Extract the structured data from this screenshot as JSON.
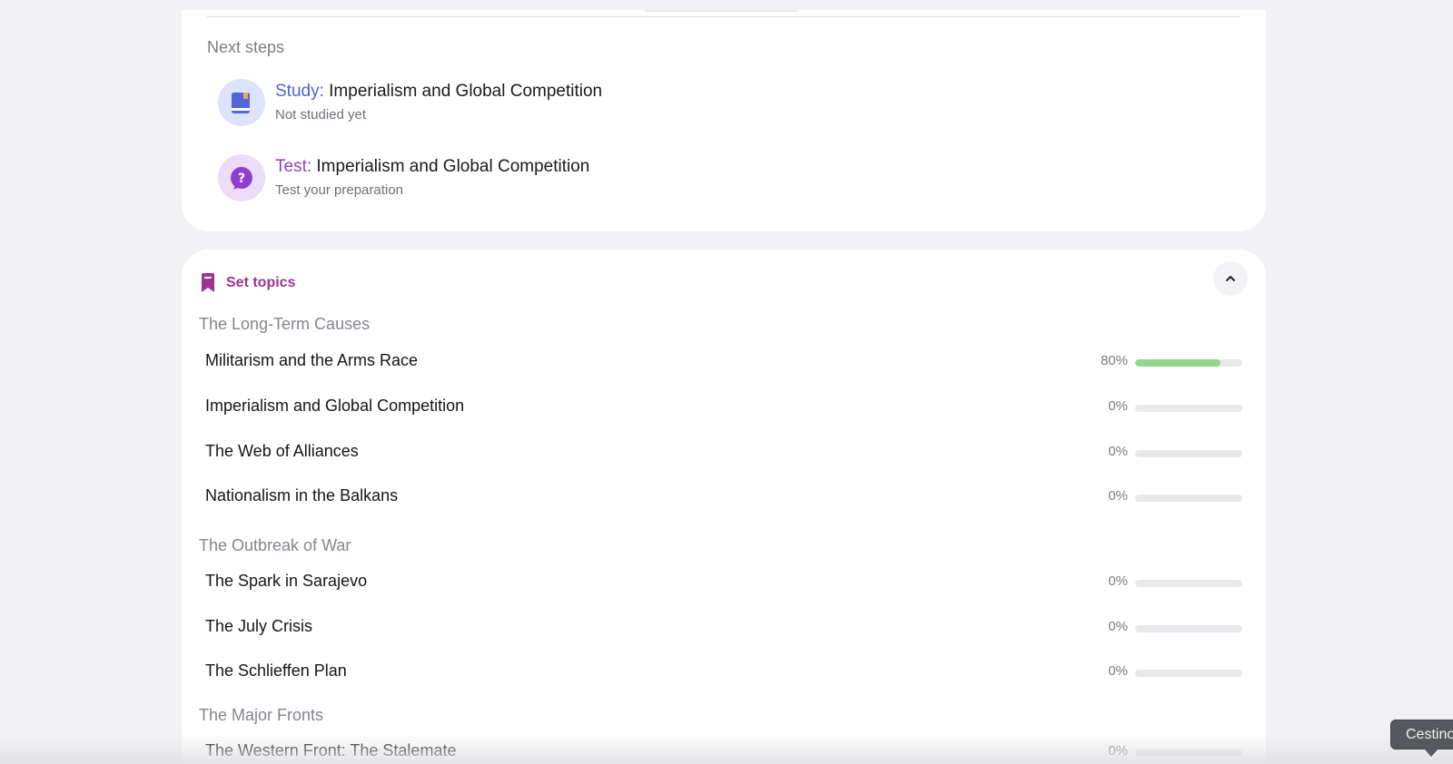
{
  "next_steps": {
    "title": "Next steps",
    "items": [
      {
        "kind": "Study:",
        "topic": "Imperialism and Global Competition",
        "subtitle": "Not studied yet",
        "icon": "book-icon"
      },
      {
        "kind": "Test:",
        "topic": "Imperialism and Global Competition",
        "subtitle": "Test your preparation",
        "icon": "question-bubble-icon"
      }
    ]
  },
  "set_topics": {
    "label": "Set topics",
    "icon": "bookmark-icon",
    "collapse_icon": "chevron-up-icon",
    "sections": [
      {
        "title": "The Long-Term Causes",
        "topics": [
          {
            "name": "Militarism and the Arms Race",
            "percent": "80%",
            "progress": 0.8
          },
          {
            "name": "Imperialism and Global Competition",
            "percent": "0%",
            "progress": 0
          },
          {
            "name": "The Web of Alliances",
            "percent": "0%",
            "progress": 0
          },
          {
            "name": "Nationalism in the Balkans",
            "percent": "0%",
            "progress": 0
          }
        ]
      },
      {
        "title": "The Outbreak of War",
        "topics": [
          {
            "name": "The Spark in Sarajevo",
            "percent": "0%",
            "progress": 0
          },
          {
            "name": "The July Crisis",
            "percent": "0%",
            "progress": 0
          },
          {
            "name": "The Schlieffen Plan",
            "percent": "0%",
            "progress": 0
          }
        ]
      },
      {
        "title": "The Major Fronts",
        "topics": [
          {
            "name": "The Western Front: The Stalemate",
            "percent": "0%",
            "progress": 0
          }
        ]
      }
    ]
  },
  "tooltip": {
    "text": "Cestino"
  },
  "colors": {
    "study": "#4f63d6",
    "test": "#8e3fd0",
    "set_topics": "#9b3592",
    "progress_fill": "#93d88a"
  }
}
